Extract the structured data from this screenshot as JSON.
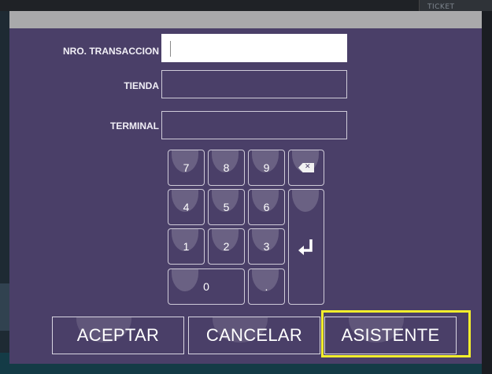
{
  "background": {
    "top_right_label": "TICKET"
  },
  "form": {
    "fields": [
      {
        "label": "NRO. TRANSACCION",
        "value": ""
      },
      {
        "label": "TIENDA",
        "value": ""
      },
      {
        "label": "TERMINAL",
        "value": ""
      }
    ]
  },
  "keypad": {
    "k7": "7",
    "k8": "8",
    "k9": "9",
    "k4": "4",
    "k5": "5",
    "k6": "6",
    "k1": "1",
    "k2": "2",
    "k3": "3",
    "k0": "0",
    "kdot": ".",
    "backspace_icon": "backspace-icon",
    "enter_icon": "enter-icon"
  },
  "buttons": {
    "accept": "ACEPTAR",
    "cancel": "CANCELAR",
    "assistant": "ASISTENTE"
  },
  "colors": {
    "dialog_bg": "#4a3f68",
    "header_bar": "#a9a9ab",
    "highlight": "#f2ee2c"
  }
}
